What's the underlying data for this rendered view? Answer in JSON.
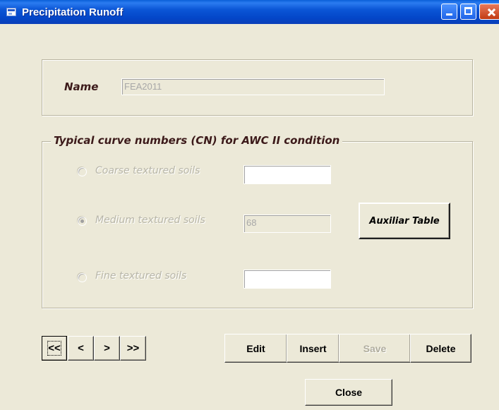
{
  "window": {
    "title": "Precipitation Runoff",
    "controls": [
      "minimize-icon",
      "maximize-icon",
      "close-icon"
    ]
  },
  "name_section": {
    "label": "Name",
    "value": "FEA2011"
  },
  "cn_section": {
    "legend": "Typical curve numbers (CN) for AWC II condition",
    "options": [
      {
        "label": "Coarse textured soils",
        "value": "",
        "selected": false
      },
      {
        "label": "Medium textured soils",
        "value": "68",
        "selected": true
      },
      {
        "label": "Fine textured soils",
        "value": "",
        "selected": false
      }
    ],
    "aux_button": "Auxiliar Table"
  },
  "navigation": {
    "first": "<<",
    "prev": "<",
    "next": ">",
    "last": ">>"
  },
  "actions": {
    "edit": "Edit",
    "insert": "Insert",
    "save": "Save",
    "delete": "Delete",
    "close": "Close"
  }
}
